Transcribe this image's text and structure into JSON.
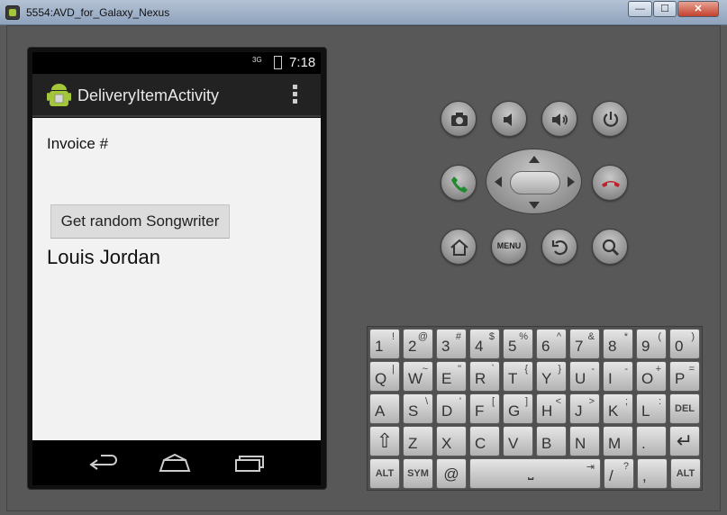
{
  "window": {
    "title": "5554:AVD_for_Galaxy_Nexus",
    "min_glyph": "—",
    "max_glyph": "☐",
    "close_glyph": "✕"
  },
  "status_bar": {
    "network": "3G",
    "time": "7:18"
  },
  "action_bar": {
    "title": "DeliveryItemActivity"
  },
  "content": {
    "invoice_label": "Invoice #",
    "button_label": "Get random Songwriter",
    "songwriter_name": "Louis Jordan"
  },
  "controls": {
    "menu_label": "MENU"
  },
  "keyboard": {
    "rows": [
      [
        {
          "k": "1",
          "s": "!"
        },
        {
          "k": "2",
          "s": "@"
        },
        {
          "k": "3",
          "s": "#"
        },
        {
          "k": "4",
          "s": "$"
        },
        {
          "k": "5",
          "s": "%"
        },
        {
          "k": "6",
          "s": "^"
        },
        {
          "k": "7",
          "s": "&"
        },
        {
          "k": "8",
          "s": "*"
        },
        {
          "k": "9",
          "s": "("
        },
        {
          "k": "0",
          "s": ")"
        }
      ],
      [
        {
          "k": "Q",
          "s": "|"
        },
        {
          "k": "W",
          "s": "~"
        },
        {
          "k": "E",
          "s": "\""
        },
        {
          "k": "R",
          "s": "`"
        },
        {
          "k": "T",
          "s": "{"
        },
        {
          "k": "Y",
          "s": "}"
        },
        {
          "k": "U",
          "s": "-"
        },
        {
          "k": "I",
          "s": "-"
        },
        {
          "k": "O",
          "s": "+"
        },
        {
          "k": "P",
          "s": "="
        }
      ],
      [
        {
          "k": "A",
          "s": ""
        },
        {
          "k": "S",
          "s": "\\"
        },
        {
          "k": "D",
          "s": "'"
        },
        {
          "k": "F",
          "s": "["
        },
        {
          "k": "G",
          "s": "]"
        },
        {
          "k": "H",
          "s": "<"
        },
        {
          "k": "J",
          "s": ">"
        },
        {
          "k": "K",
          "s": ";"
        },
        {
          "k": "L",
          "s": ":"
        },
        {
          "k": "DEL",
          "s": ""
        }
      ],
      [
        {
          "k": "⇧",
          "s": ""
        },
        {
          "k": "Z",
          "s": ""
        },
        {
          "k": "X",
          "s": ""
        },
        {
          "k": "C",
          "s": ""
        },
        {
          "k": "V",
          "s": ""
        },
        {
          "k": "B",
          "s": ""
        },
        {
          "k": "N",
          "s": ""
        },
        {
          "k": "M",
          "s": ""
        },
        {
          "k": ".",
          "s": ""
        },
        {
          "k": "↵",
          "s": ""
        }
      ]
    ],
    "bottom": {
      "alt_left": "ALT",
      "sym": "SYM",
      "at": "@",
      "space_glyph": "⎵",
      "tab_glyph": "⇥",
      "slash": "/",
      "slash_shift": "?",
      "comma": ",",
      "alt_right": "ALT"
    }
  }
}
